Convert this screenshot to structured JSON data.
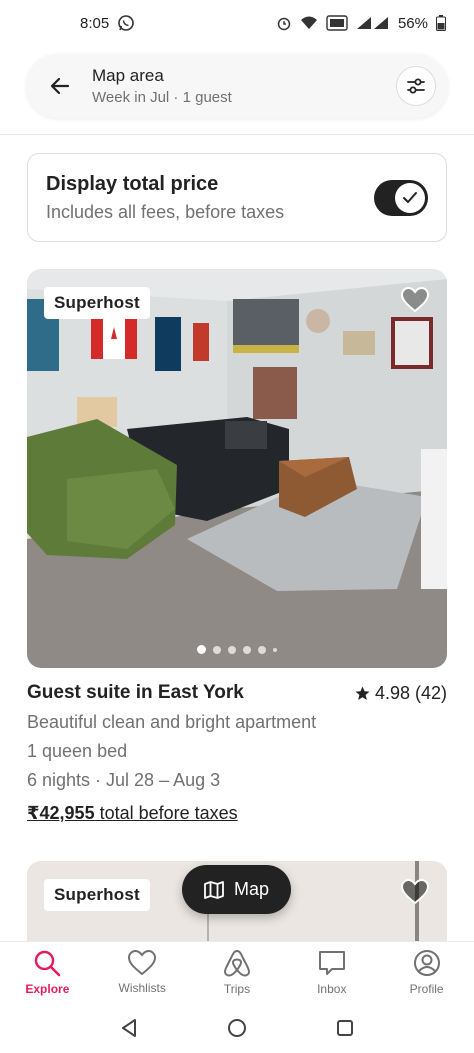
{
  "status_bar": {
    "time": "8:05",
    "battery": "56%"
  },
  "search": {
    "title": "Map area",
    "subtitle": "Week in Jul · 1 guest"
  },
  "price_toggle": {
    "title": "Display total price",
    "subtitle": "Includes all fees, before taxes",
    "enabled": true
  },
  "listings": [
    {
      "badge": "Superhost",
      "title": "Guest suite in East York",
      "rating": "4.98 (42)",
      "description": "Beautiful clean and bright apartment",
      "beds": "1 queen bed",
      "dates": "6 nights · Jul 28 – Aug 3",
      "price": "₹42,955",
      "price_suffix": " total before taxes"
    },
    {
      "badge": "Superhost"
    }
  ],
  "map_button": {
    "label": "Map"
  },
  "tabs": [
    {
      "label": "Explore",
      "icon": "search-icon",
      "active": true
    },
    {
      "label": "Wishlists",
      "icon": "heart-icon"
    },
    {
      "label": "Trips",
      "icon": "airbnb-logo-icon"
    },
    {
      "label": "Inbox",
      "icon": "message-icon"
    },
    {
      "label": "Profile",
      "icon": "user-circle-icon"
    }
  ],
  "colors": {
    "accent": "#e31c5f",
    "text": "#222222",
    "muted": "#717171"
  }
}
